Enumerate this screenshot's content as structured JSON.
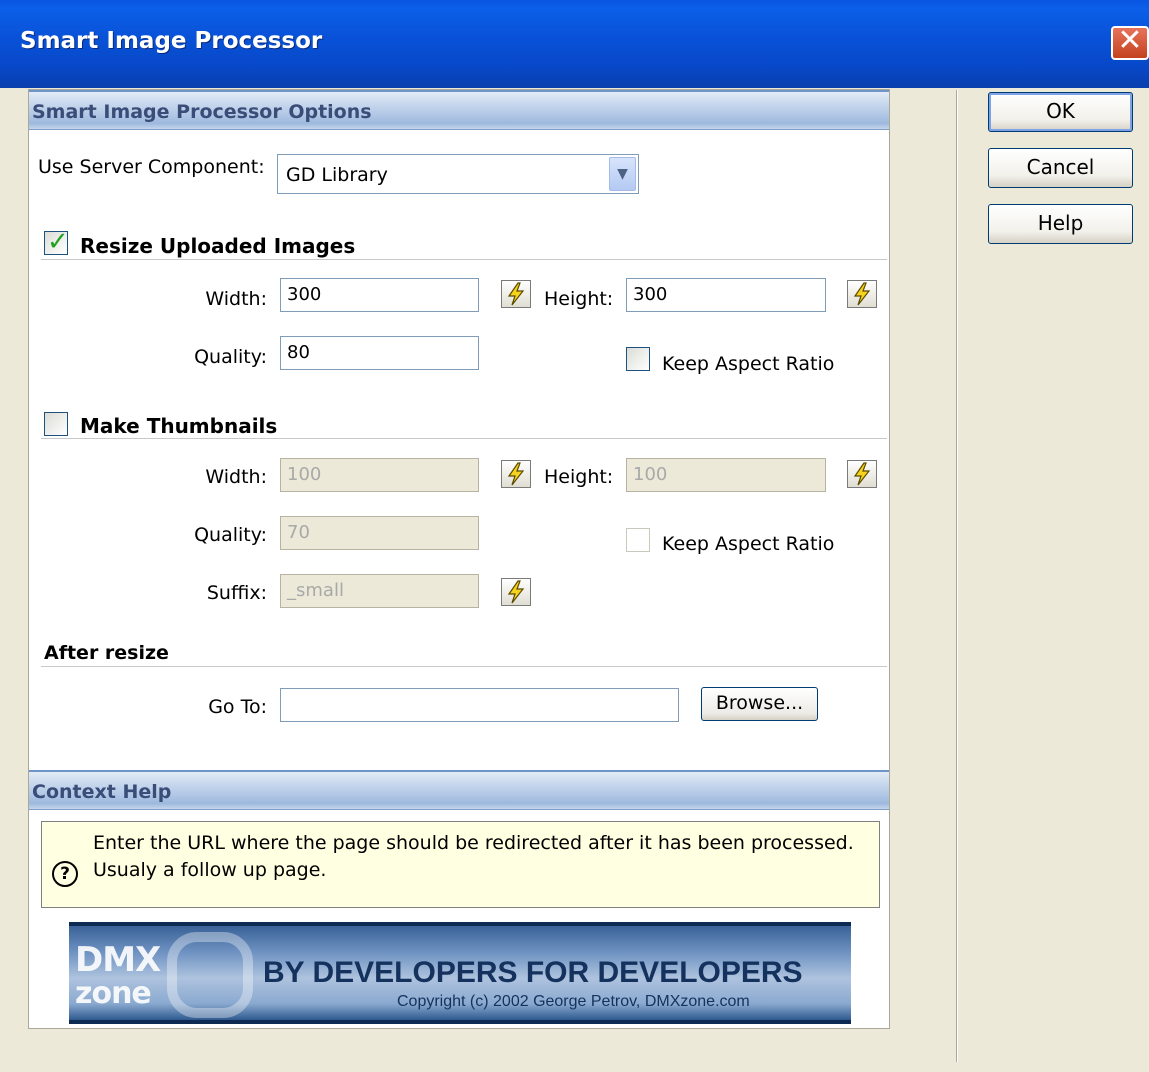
{
  "window": {
    "title": "Smart Image Processor",
    "close_glyph": "✕"
  },
  "options": {
    "header": "Smart Image Processor Options",
    "server_component": {
      "label": "Use Server Component:",
      "value": "GD Library"
    }
  },
  "resize": {
    "checked": true,
    "title": "Resize Uploaded Images",
    "width_label": "Width:",
    "width_value": "300",
    "height_label": "Height:",
    "height_value": "300",
    "quality_label": "Quality:",
    "quality_value": "80",
    "keep_aspect_label": "Keep Aspect Ratio",
    "keep_aspect_checked": false
  },
  "thumbnails": {
    "checked": false,
    "title": "Make Thumbnails",
    "width_label": "Width:",
    "width_value": "100",
    "height_label": "Height:",
    "height_value": "100",
    "quality_label": "Quality:",
    "quality_value": "70",
    "suffix_label": "Suffix:",
    "suffix_value": "_small",
    "keep_aspect_label": "Keep Aspect Ratio",
    "keep_aspect_checked": false
  },
  "after_resize": {
    "title": "After resize",
    "goto_label": "Go To:",
    "goto_value": "",
    "browse_label": "Browse..."
  },
  "context_help": {
    "header": "Context Help",
    "icon": "?",
    "text": "Enter the URL where the page should be redirected after it has been processed. Usualy a follow up page."
  },
  "banner": {
    "logo_top": "DMX",
    "logo_bottom": "zone",
    "tagline": "BY DEVELOPERS FOR DEVELOPERS",
    "copyright": "Copyright (c) 2002 George Petrov, DMXzone.com"
  },
  "buttons": {
    "ok": "OK",
    "cancel": "Cancel",
    "help": "Help"
  },
  "colors": {
    "title_bar": "#0a55e3",
    "dialog_bg": "#ece9d8",
    "section_header": "#b2c8e6",
    "help_bg": "#ffffe1"
  }
}
